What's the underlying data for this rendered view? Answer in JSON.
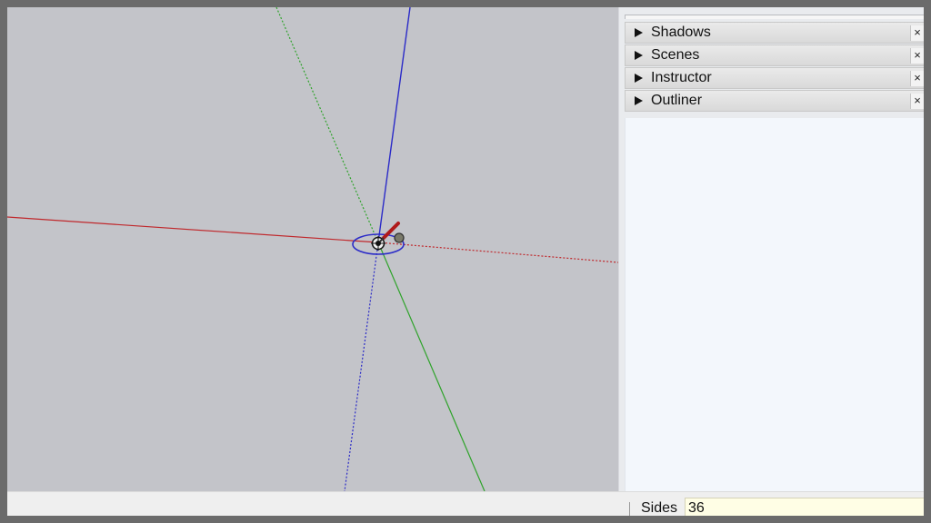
{
  "tray": {
    "panels": [
      {
        "label": "Shadows",
        "close": "×"
      },
      {
        "label": "Scenes",
        "close": "×"
      },
      {
        "label": "Instructor",
        "close": "×"
      },
      {
        "label": "Outliner",
        "close": "×"
      }
    ]
  },
  "statusbar": {
    "vcb_label": "Sides",
    "vcb_value": "36"
  },
  "colors": {
    "viewport_bg": "#c3c4c9",
    "axis_red": "#c0282c",
    "axis_green": "#2fa32b",
    "axis_blue": "#2b2bc8",
    "vcb_bg": "#fffee5"
  },
  "tool": {
    "name": "circle-tool-pencil-icon"
  }
}
